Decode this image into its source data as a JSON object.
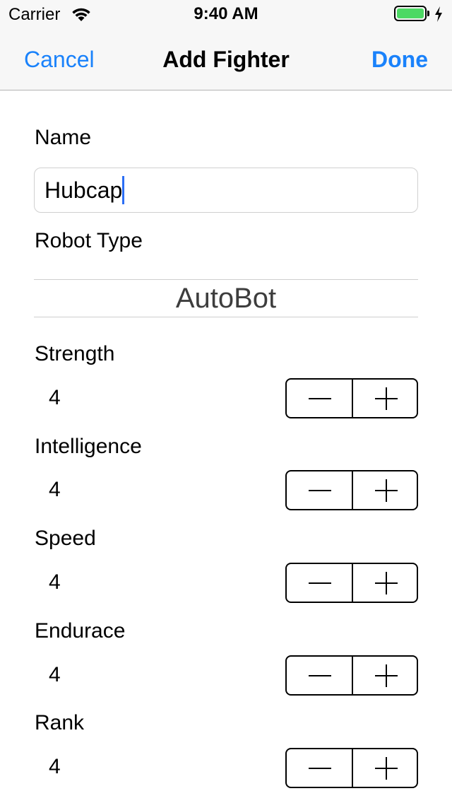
{
  "status_bar": {
    "carrier": "Carrier",
    "time": "9:40 AM",
    "battery_level": 1.0,
    "battery_color": "#4cd964"
  },
  "nav": {
    "cancel_label": "Cancel",
    "title": "Add Fighter",
    "done_label": "Done",
    "tint_color": "#1a82fb"
  },
  "form": {
    "name_label": "Name",
    "name_value": "Hubcap",
    "robot_type_label": "Robot Type",
    "robot_type_value": "AutoBot",
    "stats": [
      {
        "label": "Strength",
        "value": "4"
      },
      {
        "label": "Intelligence",
        "value": "4"
      },
      {
        "label": "Speed",
        "value": "4"
      },
      {
        "label": "Endurace",
        "value": "4"
      },
      {
        "label": "Rank",
        "value": "4"
      }
    ]
  },
  "icons": {
    "wifi": "wifi-icon",
    "battery": "battery-icon",
    "charging": "charging-bolt-icon",
    "minus": "minus-icon",
    "plus": "plus-icon"
  }
}
